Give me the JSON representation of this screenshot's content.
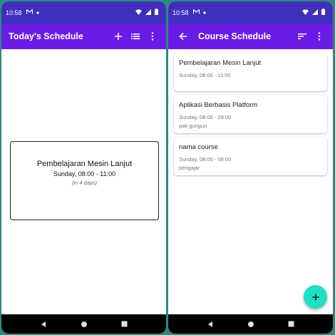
{
  "status_left": {
    "time": "10:58"
  },
  "status_right": {
    "time": "10:58"
  },
  "left_screen": {
    "title": "Today's Schedule",
    "widget": {
      "course_name": "Pembelajaran Mesin Lanjut",
      "time": "Sunday, 08:00 - 11:00",
      "relative": "(in 4 days)"
    }
  },
  "right_screen": {
    "title": "Course Schedule",
    "courses": [
      {
        "name": "Pembelajaran Mesin Lanjut",
        "time": "Sunday, 08:00 - 11:00",
        "lecturer": ""
      },
      {
        "name": "Aplikasi Berbasis Platform",
        "time": "Sunday, 08:00 - 09:00",
        "lecturer": "pak gungun"
      },
      {
        "name": "nama course",
        "time": "Sunday, 08:00 - 09:00",
        "lecturer": "pengajar"
      }
    ]
  },
  "colors": {
    "status_bar": "#3f2fbd",
    "app_bar": "#6a1ce6",
    "fab": "#1de0c4",
    "background": "#2b8a7e"
  },
  "icons": {
    "left_actions": [
      "add-icon",
      "list-icon",
      "more-vert-icon"
    ],
    "right_actions": [
      "back-arrow-icon",
      "sort-icon",
      "more-vert-icon"
    ],
    "fab": "add-icon"
  }
}
